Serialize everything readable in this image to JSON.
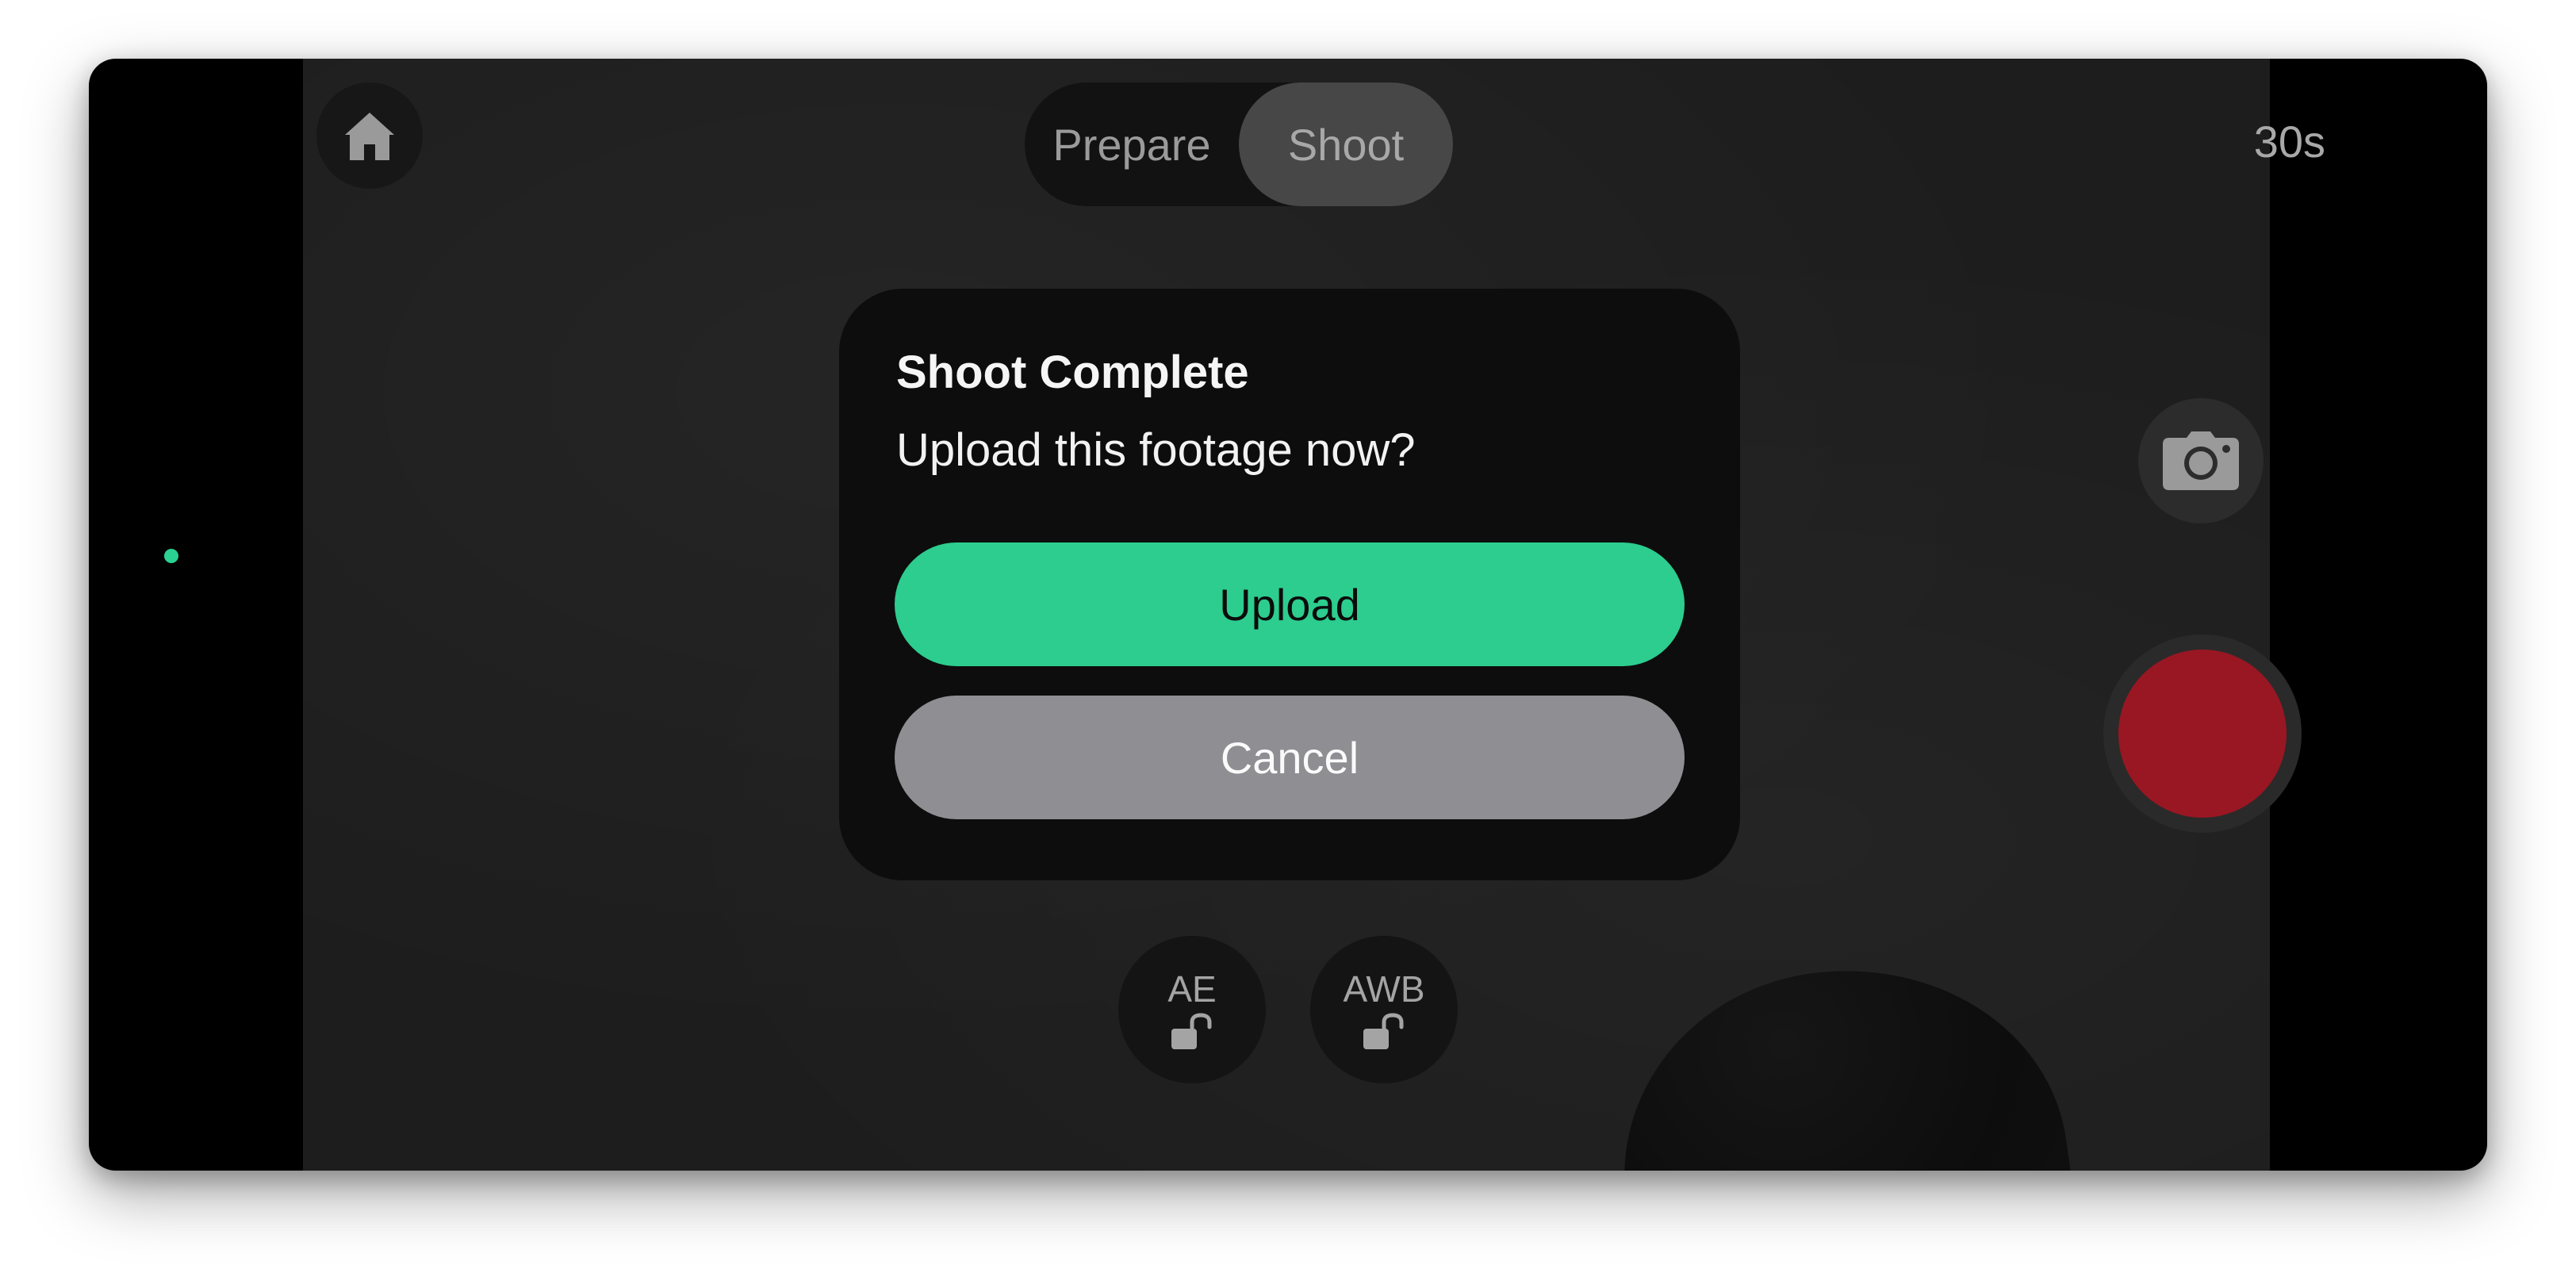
{
  "header": {
    "home_icon": "home-icon",
    "modes": [
      {
        "label": "Prepare",
        "selected": false
      },
      {
        "label": "Shoot",
        "selected": true
      }
    ],
    "timer": "30s"
  },
  "status": {
    "indicator_color": "#2bd191"
  },
  "controls": {
    "ae_label": "AE",
    "awb_label": "AWB",
    "lock_icon": "unlocked-lock-icon",
    "camera_icon": "camera-icon",
    "record_color": "#981722"
  },
  "dialog": {
    "title": "Shoot Complete",
    "message": "Upload this footage now?",
    "upload_label": "Upload",
    "cancel_label": "Cancel",
    "upload_color": "#2ccd8e",
    "cancel_color": "#8e8e93"
  }
}
